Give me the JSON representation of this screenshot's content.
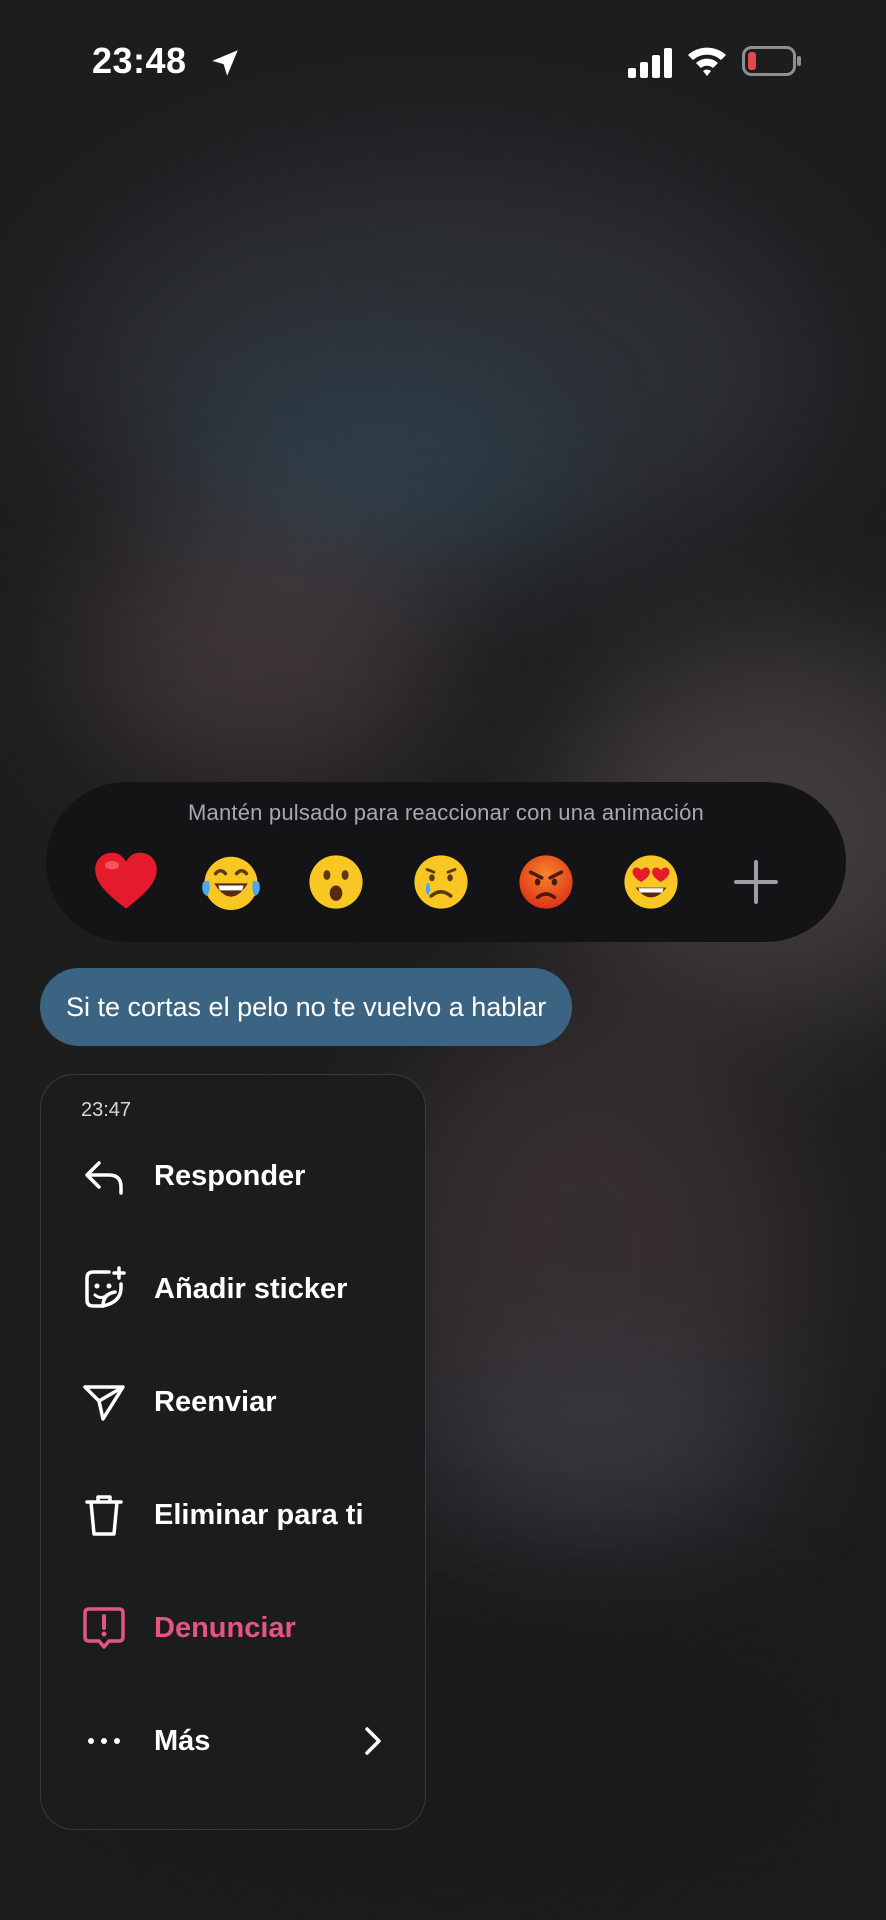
{
  "status_bar": {
    "time": "23:48",
    "battery_color": "#e5484d"
  },
  "reactions": {
    "hint": "Mantén pulsado para reaccionar con una animación",
    "emojis": [
      "❤️",
      "😂",
      "😮",
      "😢",
      "😡",
      "😍"
    ],
    "more_icon": "plus-icon"
  },
  "message": {
    "text": "Si te cortas el pelo no te vuelvo a hablar",
    "bubble_color": "#3b6483"
  },
  "menu": {
    "time": "23:47",
    "items": [
      {
        "label": "Responder",
        "icon": "reply-icon"
      },
      {
        "label": "Añadir sticker",
        "icon": "sticker-icon"
      },
      {
        "label": "Reenviar",
        "icon": "send-icon"
      },
      {
        "label": "Eliminar para ti",
        "icon": "trash-icon"
      },
      {
        "label": "Denunciar",
        "icon": "report-icon",
        "color": "#e2577e"
      },
      {
        "label": "Más",
        "icon": "more-dots-icon"
      }
    ]
  }
}
